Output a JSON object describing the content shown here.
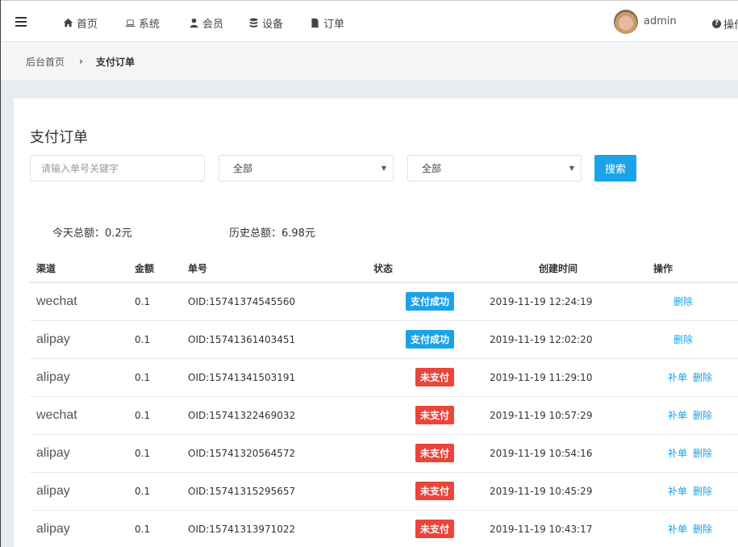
{
  "topbar": {
    "nav": [
      {
        "label": "首页",
        "icon": "home-icon"
      },
      {
        "label": "系统",
        "icon": "laptop-icon"
      },
      {
        "label": "会员",
        "icon": "user-icon"
      },
      {
        "label": "设备",
        "icon": "database-icon"
      },
      {
        "label": "订单",
        "icon": "file-icon"
      }
    ],
    "user_name": "admin",
    "help_label": "操作"
  },
  "breadcrumb": {
    "home": "后台首页",
    "separator": "›",
    "current": "支付订单"
  },
  "page": {
    "title": "支付订单",
    "search_placeholder": "请输入单号关键字",
    "filter1_value": "全部",
    "filter2_value": "全部",
    "search_button": "搜索",
    "today_total": "今天总额：0.2元",
    "history_total": "历史总额：6.98元"
  },
  "table": {
    "headers": [
      "渠道",
      "金额",
      "单号",
      "状态",
      "创建时间",
      "操作"
    ],
    "rows": [
      {
        "channel": "wechat",
        "amount": "0.1",
        "oid": "OID:15741374545560",
        "status": "支付成功",
        "status_type": "paid",
        "time": "2019-11-19 12:24:19",
        "actions": [
          "删除"
        ]
      },
      {
        "channel": "alipay",
        "amount": "0.1",
        "oid": "OID:15741361403451",
        "status": "支付成功",
        "status_type": "paid",
        "time": "2019-11-19 12:02:20",
        "actions": [
          "删除"
        ]
      },
      {
        "channel": "alipay",
        "amount": "0.1",
        "oid": "OID:15741341503191",
        "status": "未支付",
        "status_type": "unpaid",
        "time": "2019-11-19 11:29:10",
        "actions": [
          "补单",
          "删除"
        ]
      },
      {
        "channel": "wechat",
        "amount": "0.1",
        "oid": "OID:15741322469032",
        "status": "未支付",
        "status_type": "unpaid",
        "time": "2019-11-19 10:57:29",
        "actions": [
          "补单",
          "删除"
        ]
      },
      {
        "channel": "alipay",
        "amount": "0.1",
        "oid": "OID:15741320564572",
        "status": "未支付",
        "status_type": "unpaid",
        "time": "2019-11-19 10:54:16",
        "actions": [
          "补单",
          "删除"
        ]
      },
      {
        "channel": "alipay",
        "amount": "0.1",
        "oid": "OID:15741315295657",
        "status": "未支付",
        "status_type": "unpaid",
        "time": "2019-11-19 10:45:29",
        "actions": [
          "补单",
          "删除"
        ]
      },
      {
        "channel": "alipay",
        "amount": "0.1",
        "oid": "OID:15741313971022",
        "status": "未支付",
        "status_type": "unpaid",
        "time": "2019-11-19 10:43:17",
        "actions": [
          "补单",
          "删除"
        ]
      }
    ]
  },
  "colors": {
    "accent": "#1aa3e8",
    "danger": "#e9453b"
  }
}
